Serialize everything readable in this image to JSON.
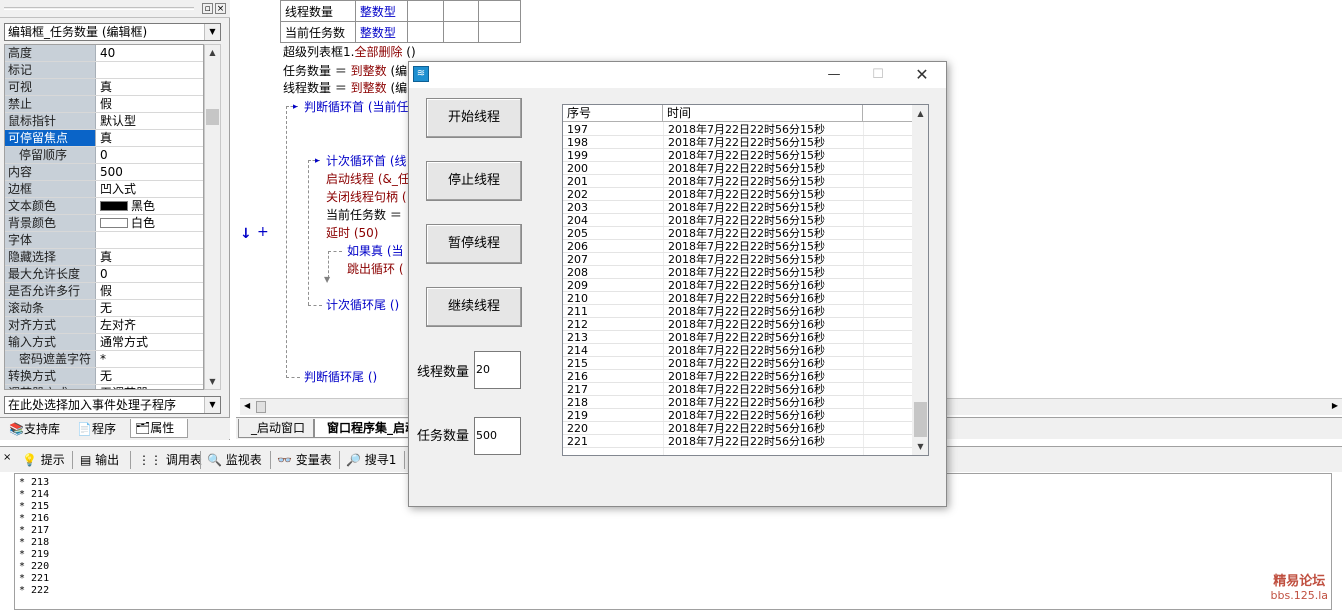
{
  "property_panel": {
    "object_selector": "编辑框_任务数量 (编辑框)",
    "properties": [
      {
        "name": "高度",
        "value": "40"
      },
      {
        "name": "标记",
        "value": ""
      },
      {
        "name": "可视",
        "value": "真"
      },
      {
        "name": "禁止",
        "value": "假"
      },
      {
        "name": "鼠标指针",
        "value": "默认型"
      },
      {
        "name": "可停留焦点",
        "value": "真"
      },
      {
        "name": "停留顺序",
        "value": "0"
      },
      {
        "name": "内容",
        "value": "500"
      },
      {
        "name": "边框",
        "value": "凹入式"
      },
      {
        "name": "文本颜色",
        "value": "黑色"
      },
      {
        "name": "背景颜色",
        "value": "白色"
      },
      {
        "name": "字体",
        "value": ""
      },
      {
        "name": "隐藏选择",
        "value": "真"
      },
      {
        "name": "最大允许长度",
        "value": "0"
      },
      {
        "name": "是否允许多行",
        "value": "假"
      },
      {
        "name": "滚动条",
        "value": "无"
      },
      {
        "name": "对齐方式",
        "value": "左对齐"
      },
      {
        "name": "输入方式",
        "value": "通常方式"
      },
      {
        "name": "密码遮盖字符",
        "value": "*"
      },
      {
        "name": "转换方式",
        "value": "无"
      },
      {
        "name": "调节器方式",
        "value": "无调节器"
      }
    ],
    "event_selector": "在此处选择加入事件处理子程序",
    "tabs": [
      "支持库",
      "程序",
      "属性"
    ],
    "colors": {
      "text_color": "#000000",
      "bg_color": "#ffffff",
      "selected_row": "#0a64c8"
    }
  },
  "code": {
    "var_table": [
      [
        "线程数量",
        "整数型"
      ],
      [
        "当前任务数",
        "整数型"
      ]
    ],
    "lines": {
      "l1_obj": "超级列表框1.",
      "l1_call": "全部删除",
      "l1_rest": " ()",
      "l2_var": "任务数量 ＝ ",
      "l2_fn": "到整数",
      "l2_rest": " (编",
      "l3_var": "线程数量 ＝ ",
      "l3_fn": "到整数",
      "l3_rest": " (编",
      "l4": "判断循环首 (当前任",
      "l5": "计次循环首 (线",
      "l6": "启动线程 (&_任",
      "l7": "关闭线程句柄 (",
      "l8": "当前任务数 ＝ ",
      "l9": "延时 (50)",
      "l10": "如果真 (当",
      "l11": "跳出循环 (",
      "l12": "计次循环尾 ()",
      "l13": "判断循环尾 ()"
    },
    "tabs": [
      "_启动窗口",
      "窗口程序集_启动"
    ]
  },
  "output": {
    "toolbar": [
      "提示",
      "输出",
      "调用表",
      "监视表",
      "变量表",
      "搜寻1"
    ],
    "lines": [
      "* 213",
      "* 214",
      "* 215",
      "* 216",
      "* 217",
      "* 218",
      "* 219",
      "* 220",
      "* 221",
      "* 222"
    ]
  },
  "watermark": {
    "line1": "精易论坛",
    "line2": "bbs.125.la"
  },
  "app_window": {
    "buttons": [
      "开始线程",
      "停止线程",
      "暂停线程",
      "继续线程"
    ],
    "thread_count_label": "线程数量",
    "thread_count_value": "20",
    "task_count_label": "任务数量",
    "task_count_value": "500",
    "list_columns": [
      "序号",
      "时间"
    ],
    "list_rows": [
      [
        "197",
        "2018年7月22日22时56分15秒"
      ],
      [
        "198",
        "2018年7月22日22时56分15秒"
      ],
      [
        "199",
        "2018年7月22日22时56分15秒"
      ],
      [
        "200",
        "2018年7月22日22时56分15秒"
      ],
      [
        "201",
        "2018年7月22日22时56分15秒"
      ],
      [
        "202",
        "2018年7月22日22时56分15秒"
      ],
      [
        "203",
        "2018年7月22日22时56分15秒"
      ],
      [
        "204",
        "2018年7月22日22时56分15秒"
      ],
      [
        "205",
        "2018年7月22日22时56分15秒"
      ],
      [
        "206",
        "2018年7月22日22时56分15秒"
      ],
      [
        "207",
        "2018年7月22日22时56分15秒"
      ],
      [
        "208",
        "2018年7月22日22时56分15秒"
      ],
      [
        "209",
        "2018年7月22日22时56分16秒"
      ],
      [
        "210",
        "2018年7月22日22时56分16秒"
      ],
      [
        "211",
        "2018年7月22日22时56分16秒"
      ],
      [
        "212",
        "2018年7月22日22时56分16秒"
      ],
      [
        "213",
        "2018年7月22日22时56分16秒"
      ],
      [
        "214",
        "2018年7月22日22时56分16秒"
      ],
      [
        "215",
        "2018年7月22日22时56分16秒"
      ],
      [
        "216",
        "2018年7月22日22时56分16秒"
      ],
      [
        "217",
        "2018年7月22日22时56分16秒"
      ],
      [
        "218",
        "2018年7月22日22时56分16秒"
      ],
      [
        "219",
        "2018年7月22日22时56分16秒"
      ],
      [
        "220",
        "2018年7月22日22时56分16秒"
      ],
      [
        "221",
        "2018年7月22日22时56分16秒"
      ]
    ]
  }
}
